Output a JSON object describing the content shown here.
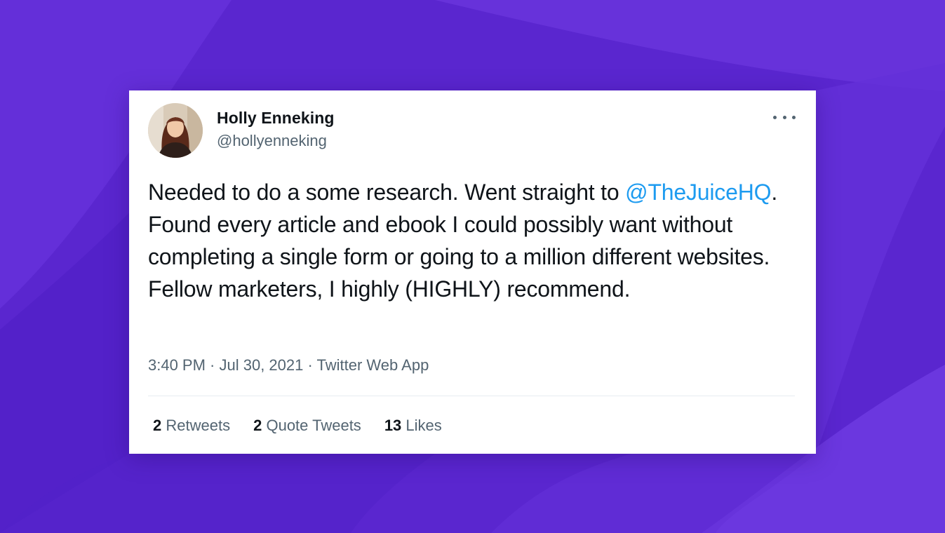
{
  "tweet": {
    "author": {
      "name": "Holly Enneking",
      "handle": "@hollyenneking"
    },
    "more_icon": "more-horizontal-icon",
    "text": {
      "before": "Needed to do a some research. Went straight to ",
      "mention": "@TheJuiceHQ",
      "after": ". Found every article and ebook I could possibly want without completing a single form or going to a million different websites. Fellow marketers, I highly (HIGHLY) recommend."
    },
    "meta": {
      "time": "3:40 PM",
      "separator": " · ",
      "date": "Jul 30, 2021",
      "source": "Twitter Web App"
    },
    "stats": {
      "retweets_count": "2",
      "retweets_label": "Retweets",
      "quotes_count": "2",
      "quotes_label": "Quote Tweets",
      "likes_count": "13",
      "likes_label": "Likes"
    }
  },
  "colors": {
    "background": "#5a26cf",
    "card": "#ffffff",
    "text": "#0f1419",
    "secondary": "#536471",
    "mention": "#1d9bf0"
  }
}
